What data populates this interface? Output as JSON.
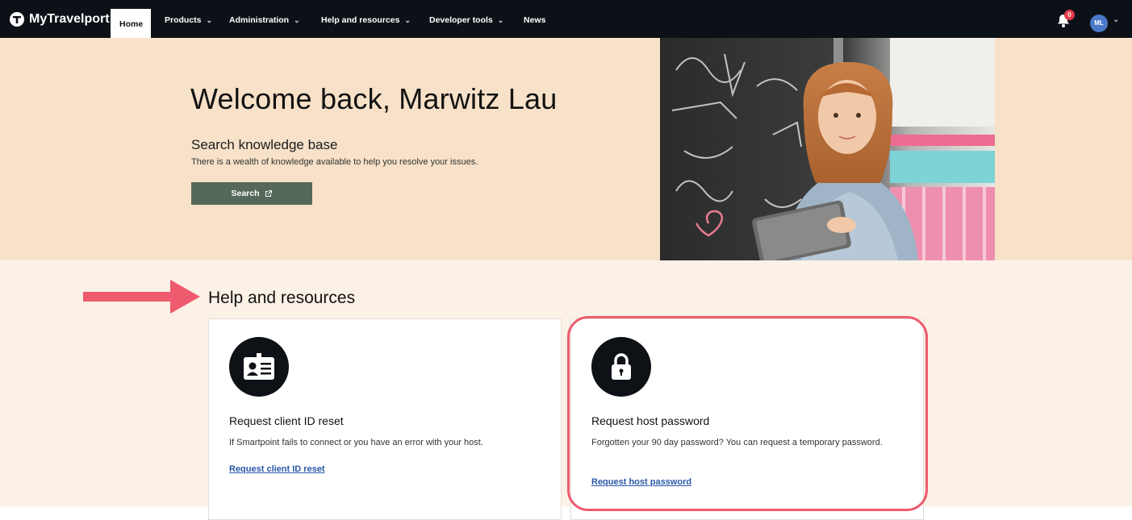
{
  "nav": {
    "logo_text": "MyTravelport",
    "items": [
      {
        "label": "Home",
        "active": true,
        "has_dropdown": false
      },
      {
        "label": "Products",
        "has_dropdown": true
      },
      {
        "label": "Administration",
        "has_dropdown": true
      },
      {
        "label": "Help and resources",
        "has_dropdown": true
      },
      {
        "label": "Developer tools",
        "has_dropdown": true
      },
      {
        "label": "News",
        "has_dropdown": false
      }
    ],
    "notifications_count": "0",
    "avatar_initials": "ML",
    "icons": {
      "bell": "bell-icon",
      "avatar_menu": "chevron-down-icon"
    }
  },
  "hero": {
    "title": "Welcome back, Marwitz Lau",
    "subtitle": "Search knowledge base",
    "description": "There is a wealth of knowledge available to help you resolve your issues.",
    "search_button": "Search"
  },
  "help": {
    "title": "Help and resources",
    "cards": [
      {
        "icon": "id-badge-icon",
        "title": "Request client ID reset",
        "description": "If Smartpoint fails to connect or you have an error with your host.",
        "link": "Request client ID reset"
      },
      {
        "icon": "lock-icon",
        "title": "Request host password",
        "description": "Forgotten your 90 day password? You can request a temporary password.",
        "link": "Request host password"
      }
    ]
  },
  "colors": {
    "nav_bg": "#0c1117",
    "hero_bg": "#f7e1c8",
    "section_bg": "#fcf1e6",
    "search_button": "#56685a",
    "link": "#2a58a8",
    "highlight": "#ee5b6e"
  }
}
